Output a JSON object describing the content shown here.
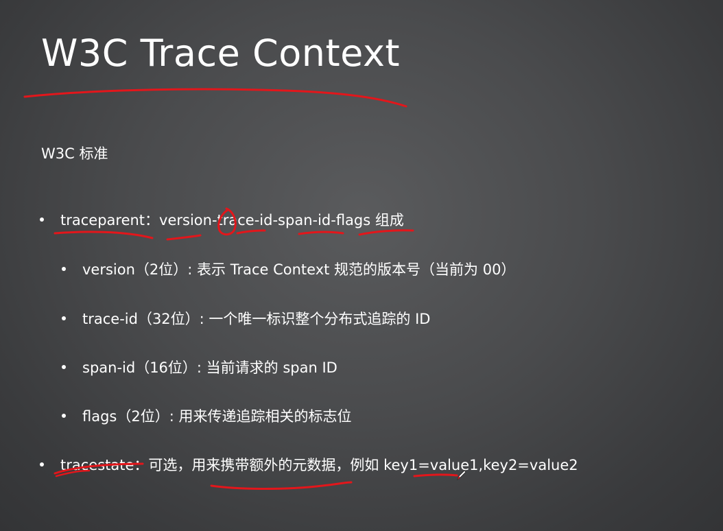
{
  "slide": {
    "title": "W3C Trace Context",
    "subtitle": "W3C 标准",
    "bullets": [
      {
        "text": "traceparent：version-trace-id-span-id-flags 组成"
      },
      {
        "text": "version（2位）: 表示 Trace Context 规范的版本号（当前为 00）"
      },
      {
        "text": "trace-id（32位）: 一个唯一标识整个分布式追踪的 ID"
      },
      {
        "text": "span-id（16位）: 当前请求的 span ID"
      },
      {
        "text": "flags（2位）: 用来传递追踪相关的标志位"
      },
      {
        "text": "tracestate：可选，用来携带额外的元数据，例如 key1=value1,key2=value2"
      }
    ]
  },
  "colors": {
    "annotation": "#e3161b",
    "text": "#ffffff"
  },
  "icons": {
    "cursor": "pen-cursor-icon"
  }
}
